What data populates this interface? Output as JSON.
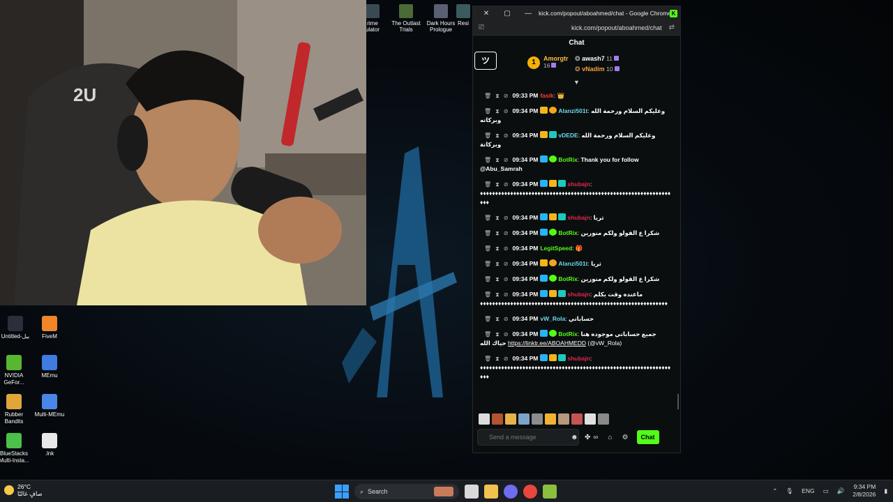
{
  "top_shortcuts": [
    {
      "label": "rime\nulator"
    },
    {
      "label": "The Outlast\nTrials"
    },
    {
      "label": "Dark Hours\nPrologue"
    },
    {
      "label": "Resi"
    }
  ],
  "desktop_icons": [
    {
      "label": "Untitled-بيل",
      "color": "#2a2f3a"
    },
    {
      "label": "FiveM",
      "color": "#f0852a"
    },
    {
      "label": "NVIDIA GeFor...",
      "color": "#59b630"
    },
    {
      "label": "MEmu",
      "color": "#3f7be0"
    },
    {
      "label": "Rubber Bandits",
      "color": "#e0a63a"
    },
    {
      "label": "Multi-MEmu",
      "color": "#4a86e8"
    },
    {
      "label": "BlueStacks Multi-Insta...",
      "color": "#4bc04a"
    },
    {
      "label": ".lnk",
      "color": "#e8e8e8"
    }
  ],
  "window": {
    "title": "kick.com/popout/aboahmed/chat - Google Chrome",
    "url": "kick.com/popout/aboahmed/chat",
    "close_glyph": "✕",
    "restore_glyph": "▢",
    "minimize_glyph": "—",
    "kick_logo": "K"
  },
  "chat": {
    "header": "Chat",
    "logo_text": "ツ",
    "leaderboard": {
      "first": {
        "rank": "1",
        "name": "Amorgtr",
        "count": "16"
      },
      "second": {
        "name": "awash7",
        "count": "11"
      },
      "third": {
        "name": "vNadim",
        "count": "10"
      }
    },
    "messages": [
      {
        "time": "09:33 PM",
        "user": "fasik",
        "user_color": "#ff3b3b",
        "text": "👑",
        "badges": []
      },
      {
        "time": "09:34 PM",
        "user": "Alanzi501t",
        "user_color": "#6fd6e8",
        "text": "وعليكم السلام ورحمة الله وبركاته",
        "badges": [
          "b-vip",
          "b-og"
        ]
      },
      {
        "time": "09:34 PM",
        "user": "vDEDE",
        "user_color": "#6fd6e8",
        "text": "وعليكم السلام ورحمة الله وبركاتة",
        "badges": [
          "b-vip",
          "b-sub"
        ]
      },
      {
        "time": "09:34 PM",
        "user": "BotRix",
        "user_color": "#53fc18",
        "text": "Thank you for follow @Abu_Samrah",
        "badges": [
          "b-mod",
          "b-ok"
        ]
      },
      {
        "time": "09:34 PM",
        "user": "shubajn",
        "user_color": "#e0264a",
        "text": "♦♦♦♦♦♦♦♦♦♦♦♦♦♦♦♦♦♦♦♦♦♦♦♦♦♦♦♦♦♦♦♦♦♦♦♦♦♦♦♦♦♦♦♦♦♦♦♦♦♦♦♦♦♦♦♦♦♦♦♦♦♦♦♦♦♦",
        "badges": [
          "b-mod",
          "b-vip",
          "b-sub"
        ]
      },
      {
        "time": "09:34 PM",
        "user": "shubajn",
        "user_color": "#e0264a",
        "text": "ثريا",
        "badges": [
          "b-mod",
          "b-vip",
          "b-sub"
        ]
      },
      {
        "time": "09:34 PM",
        "user": "BotRix",
        "user_color": "#53fc18",
        "text": "شكرا ع القولو ولكم منورين",
        "badges": [
          "b-mod",
          "b-ok"
        ]
      },
      {
        "time": "09:34 PM",
        "user": "LegitSpeed",
        "user_color": "#53fc18",
        "text": "🎁",
        "badges": []
      },
      {
        "time": "09:34 PM",
        "user": "Alanzi501t",
        "user_color": "#6fd6e8",
        "text": "ثريا",
        "badges": [
          "b-vip",
          "b-og"
        ]
      },
      {
        "time": "09:34 PM",
        "user": "BotRix",
        "user_color": "#53fc18",
        "text": "شكرا ع القولو ولكم منورين",
        "badges": [
          "b-mod",
          "b-ok"
        ]
      },
      {
        "time": "09:34 PM",
        "user": "shubajn",
        "user_color": "#e0264a",
        "text": "ماعنده وقت يكلم ♦♦♦♦♦♦♦♦♦♦♦♦♦♦♦♦♦♦♦♦♦♦♦♦♦♦♦♦♦♦♦♦♦♦♦♦♦♦♦♦♦♦♦♦♦♦♦♦♦♦♦♦♦♦♦♦♦♦♦♦♦♦",
        "badges": [
          "b-mod",
          "b-vip",
          "b-sub"
        ]
      },
      {
        "time": "09:34 PM",
        "user": "vW_Rola",
        "user_color": "#6fd6e8",
        "text": "حساباتي",
        "badges": []
      },
      {
        "time": "09:34 PM",
        "user": "BotRix",
        "user_color": "#53fc18",
        "text": "جميع حساباتي موجوده هنا حياك الله",
        "link": "https://linktr.ee/ABOAHMEDD",
        "after": "(@vW_Rola)",
        "badges": [
          "b-mod",
          "b-ok"
        ]
      },
      {
        "time": "09:34 PM",
        "user": "shubajn",
        "user_color": "#e0264a",
        "text": "♦♦♦♦♦♦♦♦♦♦♦♦♦♦♦♦♦♦♦♦♦♦♦♦♦♦♦♦♦♦♦♦♦♦♦♦♦♦♦♦♦♦♦♦♦♦♦♦♦♦♦♦♦♦♦♦♦♦♦♦♦♦♦♦♦♦",
        "badges": [
          "b-mod",
          "b-vip",
          "b-sub"
        ]
      }
    ],
    "emote_colors": [
      "#dcdcdc",
      "#b3532f",
      "#e6b24a",
      "#7ba4c9",
      "#8c8c8c",
      "#f2b134",
      "#b8977a",
      "#c35454",
      "#e0e0e0",
      "#8a8a8a"
    ],
    "composer": {
      "placeholder": "Send a message",
      "send_label": "Chat"
    }
  },
  "taskbar": {
    "weather_temp": "26°C",
    "weather_desc": "صافٍ غالبًا",
    "search_label": "Search",
    "lang": "ENG",
    "time": "9:34 PM",
    "date": "2/8/2026"
  }
}
